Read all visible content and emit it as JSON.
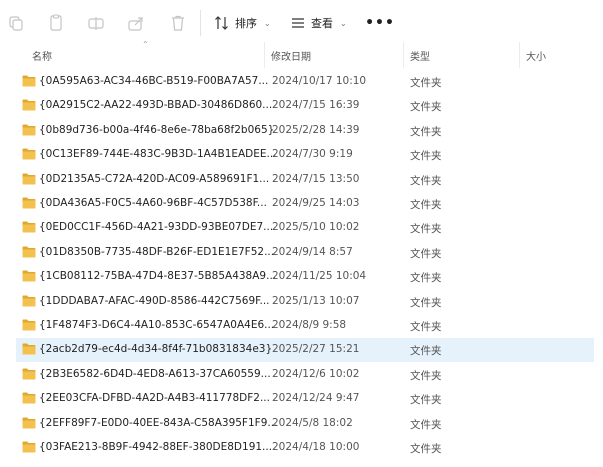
{
  "toolbar": {
    "sort_label": "排序",
    "view_label": "查看"
  },
  "header": {
    "name": "名称",
    "date": "修改日期",
    "type": "类型",
    "size": "大小"
  },
  "files": [
    {
      "name": "{0A595A63-AC34-46BC-B519-F00BA7A57...",
      "date": "2024/10/17 10:10",
      "type": "文件夹"
    },
    {
      "name": "{0A2915C2-AA22-493D-BBAD-30486D860...",
      "date": "2024/7/15 16:39",
      "type": "文件夹"
    },
    {
      "name": "{0b89d736-b00a-4f46-8e6e-78ba68f2b065}",
      "date": "2025/2/28 14:39",
      "type": "文件夹"
    },
    {
      "name": "{0C13EF89-744E-483C-9B3D-1A4B1EADEE...",
      "date": "2024/7/30 9:19",
      "type": "文件夹"
    },
    {
      "name": "{0D2135A5-C72A-420D-AC09-A589691F1...",
      "date": "2024/7/15 13:50",
      "type": "文件夹"
    },
    {
      "name": "{0DA436A5-F0C5-4A60-96BF-4C57D538F...",
      "date": "2024/9/25 14:03",
      "type": "文件夹"
    },
    {
      "name": "{0ED0CC1F-456D-4A21-93DD-93BE07DE7...",
      "date": "2025/5/10 10:02",
      "type": "文件夹"
    },
    {
      "name": "{01D8350B-7735-48DF-B26F-ED1E1E7F52...",
      "date": "2024/9/14 8:57",
      "type": "文件夹"
    },
    {
      "name": "{1CB08112-75BA-47D4-8E37-5B85A438A9...",
      "date": "2024/11/25 10:04",
      "type": "文件夹"
    },
    {
      "name": "{1DDDABA7-AFAC-490D-8586-442C7569F...",
      "date": "2025/1/13 10:07",
      "type": "文件夹"
    },
    {
      "name": "{1F4874F3-D6C4-4A10-853C-6547A0A4E6...",
      "date": "2024/8/9 9:58",
      "type": "文件夹"
    },
    {
      "name": "{2acb2d79-ec4d-4d34-8f4f-71b0831834e3}",
      "date": "2025/2/27 15:21",
      "type": "文件夹",
      "selected": true
    },
    {
      "name": "{2B3E6582-6D4D-4ED8-A613-37CA60559...",
      "date": "2024/12/6 10:02",
      "type": "文件夹"
    },
    {
      "name": "{2EE03CFA-DFBD-4A2D-A4B3-411778DF2...",
      "date": "2024/12/24 9:47",
      "type": "文件夹"
    },
    {
      "name": "{2EFF89F7-E0D0-40EE-843A-C58A395F1F9...",
      "date": "2024/5/8 18:02",
      "type": "文件夹"
    },
    {
      "name": "{03FAE213-8B9F-4942-88EF-380DE8D191...",
      "date": "2024/4/18 10:00",
      "type": "文件夹"
    }
  ],
  "colors": {
    "folder": "#f2c14e",
    "folder_dark": "#e0a92e",
    "selected_row": "#e5f1fb"
  }
}
